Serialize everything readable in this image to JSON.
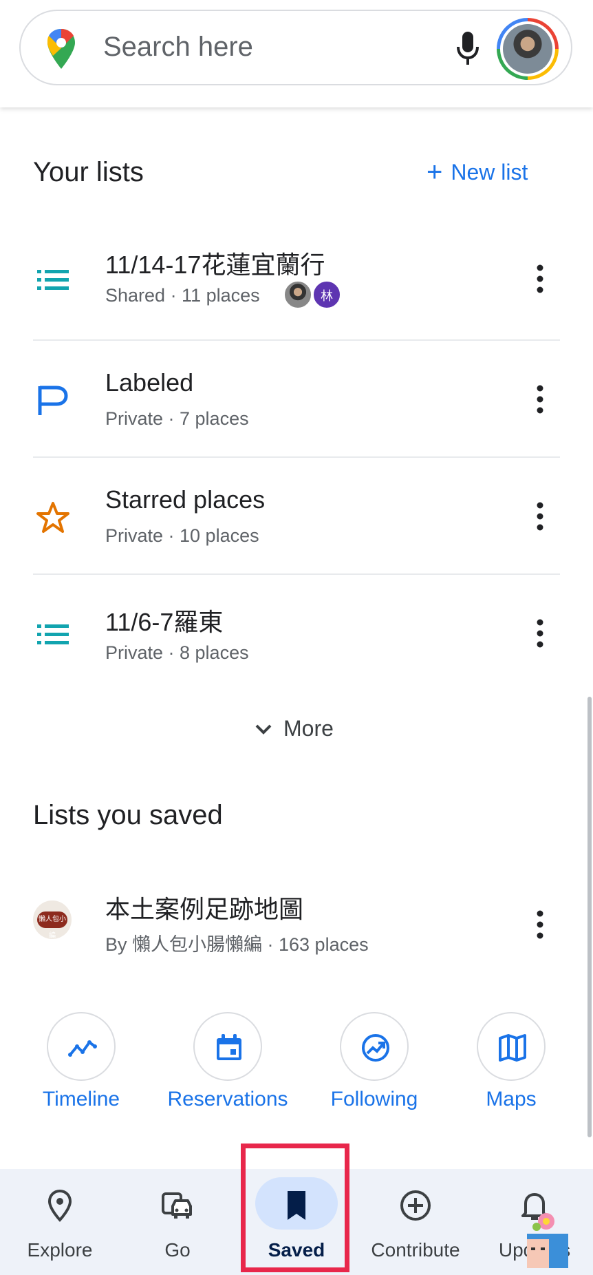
{
  "search": {
    "placeholder": "Search here"
  },
  "your_lists": {
    "title": "Your lists",
    "new_list_label": "New list",
    "items": [
      {
        "title": "11/14-17花蓮宜蘭行",
        "subtitle": "Shared · 11 places",
        "icon": "list-icon",
        "sharer_initial": "林"
      },
      {
        "title": "Labeled",
        "subtitle": "Private · 7 places",
        "icon": "label-flag-icon"
      },
      {
        "title": "Starred places",
        "subtitle": "Private · 10 places",
        "icon": "star-icon"
      },
      {
        "title": "11/6-7羅東",
        "subtitle": "Private · 8 places",
        "icon": "list-icon"
      }
    ],
    "more_label": "More"
  },
  "lists_you_saved": {
    "title": "Lists you saved",
    "items": [
      {
        "title": "本土案例足跡地圖",
        "subtitle": "By 懶人包小腸懶編 · 163 places",
        "logo_text": "懶人包小編"
      }
    ]
  },
  "shortcuts": [
    {
      "label": "Timeline",
      "icon": "timeline-icon"
    },
    {
      "label": "Reservations",
      "icon": "calendar-icon"
    },
    {
      "label": "Following",
      "icon": "trending-icon"
    },
    {
      "label": "Maps",
      "icon": "map-icon"
    }
  ],
  "bottom_nav": [
    {
      "label": "Explore",
      "icon": "location-pin-icon"
    },
    {
      "label": "Go",
      "icon": "car-icon"
    },
    {
      "label": "Saved",
      "icon": "bookmark-icon",
      "active": true
    },
    {
      "label": "Contribute",
      "icon": "add-circle-icon"
    },
    {
      "label": "Updates",
      "icon": "bell-icon"
    }
  ],
  "colors": {
    "accent": "#1a73e8",
    "highlight": "#e8274b",
    "list_icon": "#12a4af",
    "star": "#e37400"
  }
}
